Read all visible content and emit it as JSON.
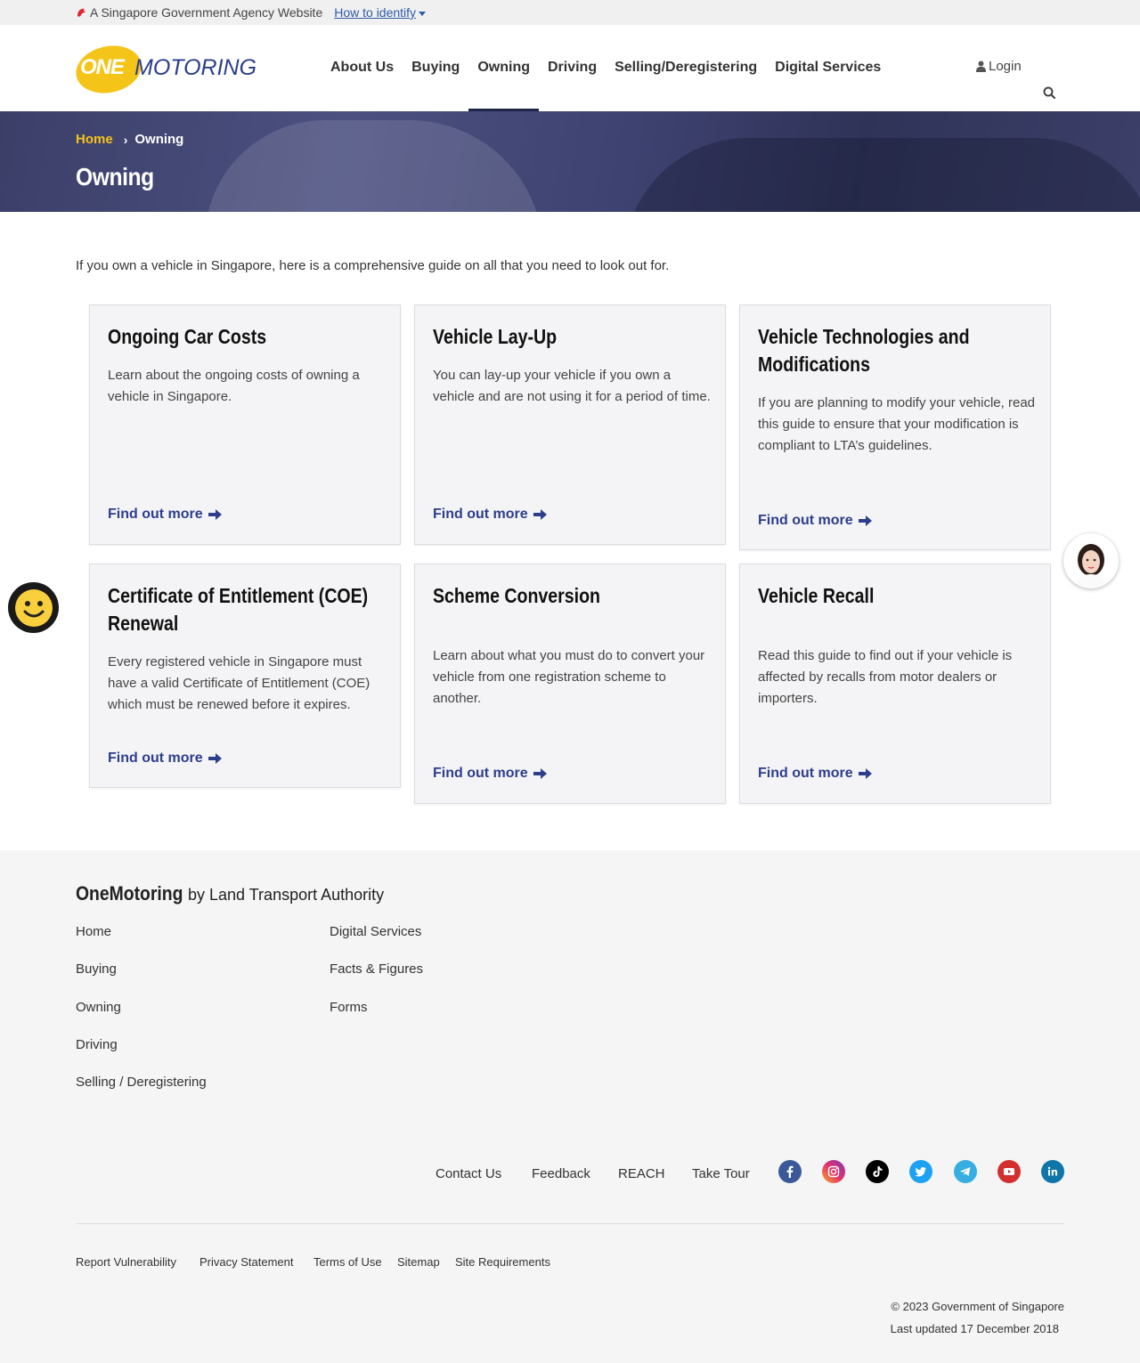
{
  "gov_bar": {
    "text": "A Singapore Government Agency Website",
    "identify": "How to identify"
  },
  "logo": {
    "one": "ONE",
    "motoring": "MOTORING"
  },
  "nav": [
    "About Us",
    "Buying",
    "Owning",
    "Driving",
    "Selling/Deregistering",
    "Digital Services"
  ],
  "nav_active": "Owning",
  "login": "Login",
  "breadcrumb": {
    "home": "Home",
    "current": "Owning"
  },
  "page_title": "Owning",
  "intro": "If you own a vehicle in Singapore, here is a comprehensive guide on all that you need to look out for.",
  "cards": [
    {
      "title": "Ongoing Car Costs",
      "desc": "Learn about the ongoing costs of owning a vehicle in Singapore.",
      "more": "Find out more"
    },
    {
      "title": "Vehicle Lay-Up",
      "desc": "You can lay-up your vehicle if you own a vehicle and are not using it for a period of time.",
      "more": "Find out more"
    },
    {
      "title": "Vehicle Technologies and Modifications",
      "desc": "If you are planning to modify your vehicle, read this guide to ensure that your modification is compliant to LTA’s guidelines.",
      "more": "Find out more"
    },
    {
      "title": "Certificate of Entitlement (COE) Renewal",
      "desc": "Every registered vehicle in Singapore must have a valid Certificate of Entitlement (COE) which must be renewed before it expires.",
      "more": "Find out more"
    },
    {
      "title": "Scheme Conversion",
      "desc": "Learn about what you must do to convert your vehicle from one registration scheme to another.",
      "more": "Find out more"
    },
    {
      "title": "Vehicle Recall",
      "desc": "Read this guide to find out if your vehicle is affected by recalls from motor dealers or importers.",
      "more": "Find out more"
    }
  ],
  "footer": {
    "brand_name": "OneMotoring",
    "brand_by": "by Land Transport Authority",
    "col1": [
      "Home",
      "Buying",
      "Owning",
      "Driving",
      "Selling / Deregistering"
    ],
    "col2": [
      "Digital Services",
      "Facts & Figures",
      "Forms"
    ],
    "bottom_links": [
      "Contact Us",
      "Feedback",
      "REACH",
      "Take Tour"
    ],
    "social": [
      "facebook-icon",
      "instagram-icon",
      "tiktok-icon",
      "twitter-icon",
      "telegram-icon",
      "youtube-icon",
      "linkedin-icon"
    ],
    "legal": [
      "Report Vulnerability",
      "Privacy Statement",
      "Terms of Use",
      "Sitemap",
      "Site Requirements"
    ],
    "copyright": "© 2023 Government of Singapore",
    "updated": "Last updated 17 December 2018"
  },
  "colors": {
    "brand_blue": "#2d3e8c",
    "brand_yellow": "#f5c419",
    "banner": "#3b3f68"
  }
}
